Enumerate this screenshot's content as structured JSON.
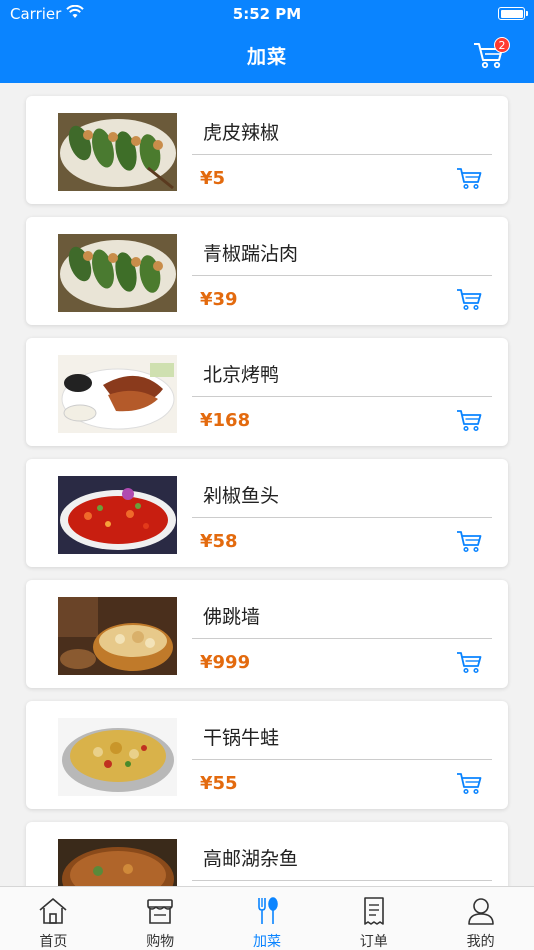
{
  "status_bar": {
    "carrier": "Carrier",
    "time": "5:52 PM"
  },
  "nav": {
    "title": "加菜",
    "cart_badge": "2"
  },
  "dishes": [
    {
      "name": "虎皮辣椒",
      "price": "¥5"
    },
    {
      "name": "青椒踹沾肉",
      "price": "¥39"
    },
    {
      "name": "北京烤鸭",
      "price": "¥168"
    },
    {
      "name": "剁椒鱼头",
      "price": "¥58"
    },
    {
      "name": "佛跳墙",
      "price": "¥999"
    },
    {
      "name": "干锅牛蛙",
      "price": "¥55"
    },
    {
      "name": "高邮湖杂鱼",
      "price": ""
    }
  ],
  "tabs": [
    {
      "label": "首页",
      "icon": "home-icon"
    },
    {
      "label": "购物",
      "icon": "store-icon"
    },
    {
      "label": "加菜",
      "icon": "fork-spoon-icon",
      "active": true
    },
    {
      "label": "订单",
      "icon": "receipt-icon"
    },
    {
      "label": "我的",
      "icon": "user-icon"
    }
  ],
  "colors": {
    "primary": "#0a84ff",
    "price": "#e36a0e",
    "badge": "#ff3b30"
  }
}
